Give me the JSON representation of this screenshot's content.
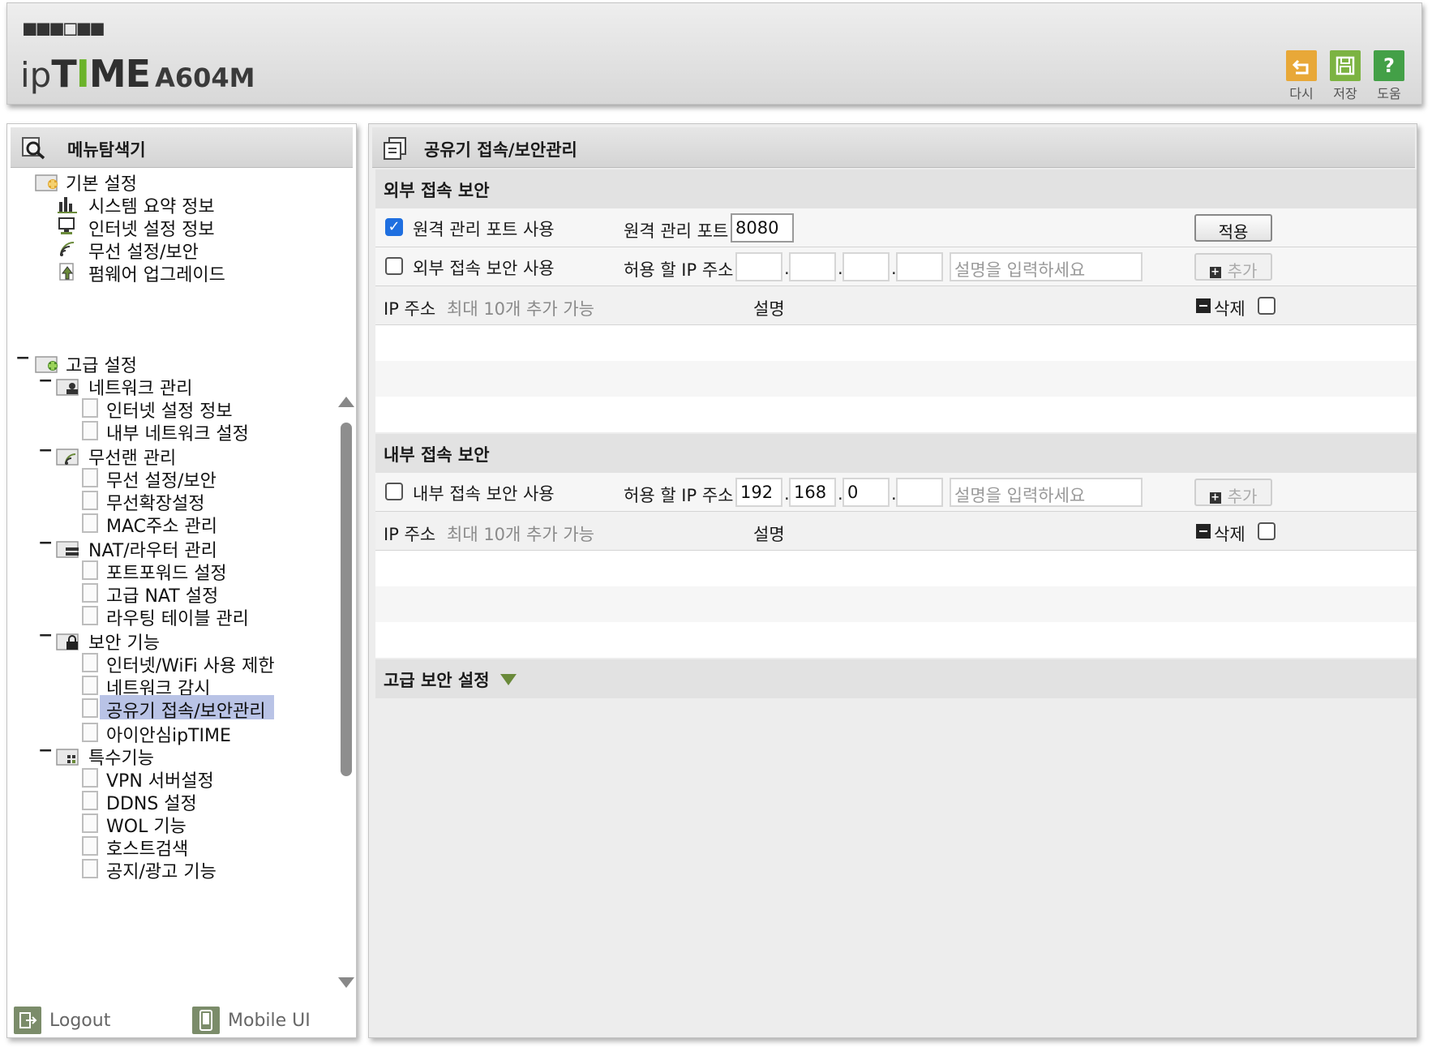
{
  "header": {
    "brand_mark": "■■■□■■",
    "logo_ip": "ip",
    "logo_time_t": "T",
    "logo_time_i": "I",
    "logo_time_me": "ME",
    "model": "A604M",
    "toolbar": [
      {
        "label": "다시",
        "icon": "undo-icon",
        "color": "#e8a838"
      },
      {
        "label": "저장",
        "icon": "save-icon",
        "color": "#7cb342"
      },
      {
        "label": "도움",
        "icon": "help-icon",
        "color": "#43a047"
      }
    ]
  },
  "menu": {
    "title": "메뉴탐색기",
    "basic": {
      "label": "기본 설정",
      "items": [
        "시스템 요약 정보",
        "인터넷 설정 정보",
        "무선 설정/보안",
        "펌웨어 업그레이드"
      ]
    },
    "advanced": {
      "label": "고급 설정",
      "groups": [
        {
          "label": "네트워크 관리",
          "items": [
            "인터넷 설정 정보",
            "내부 네트워크 설정"
          ]
        },
        {
          "label": "무선랜 관리",
          "items": [
            "무선 설정/보안",
            "무선확장설정",
            "MAC주소 관리"
          ]
        },
        {
          "label": "NAT/라우터 관리",
          "items": [
            "포트포워드 설정",
            "고급 NAT 설정",
            "라우팅 테이블 관리"
          ]
        },
        {
          "label": "보안 기능",
          "items": [
            "인터넷/WiFi 사용 제한",
            "네트워크 감시",
            "공유기 접속/보안관리",
            "아이안심ipTIME"
          ]
        },
        {
          "label": "특수기능",
          "items": [
            "VPN 서버설정",
            "DDNS 설정",
            "WOL 기능",
            "호스트검색",
            "공지/광고 기능"
          ]
        }
      ]
    },
    "selected_item": "공유기 접속/보안관리",
    "logout_label": "Logout",
    "mobile_label": "Mobile UI"
  },
  "main": {
    "title": "공유기 접속/보안관리",
    "external": {
      "heading": "외부 접속 보안",
      "remote_port_checkbox_label": "원격 관리 포트 사용",
      "remote_port_checked": true,
      "remote_port_label": "원격 관리 포트",
      "remote_port_value": "8080",
      "apply_label": "적용",
      "security_checkbox_label": "외부 접속 보안 사용",
      "security_checked": false,
      "allowed_ip_label": "허용 할 IP 주소",
      "ip_octets": [
        "",
        "",
        "",
        ""
      ],
      "desc_placeholder": "설명을 입력하세요",
      "add_label": "추가",
      "list_ip_header": "IP 주소",
      "list_ip_hint": "최대 10개 추가 가능",
      "list_desc_header": "설명",
      "delete_label": "삭제"
    },
    "internal": {
      "heading": "내부 접속 보안",
      "security_checkbox_label": "내부 접속 보안 사용",
      "security_checked": false,
      "allowed_ip_label": "허용 할 IP 주소",
      "ip_octets": [
        "192",
        "168",
        "0",
        ""
      ],
      "desc_placeholder": "설명을 입력하세요",
      "add_label": "추가",
      "list_ip_header": "IP 주소",
      "list_ip_hint": "최대 10개 추가 가능",
      "list_desc_header": "설명",
      "delete_label": "삭제"
    },
    "advanced_heading": "고급 보안 설정"
  }
}
